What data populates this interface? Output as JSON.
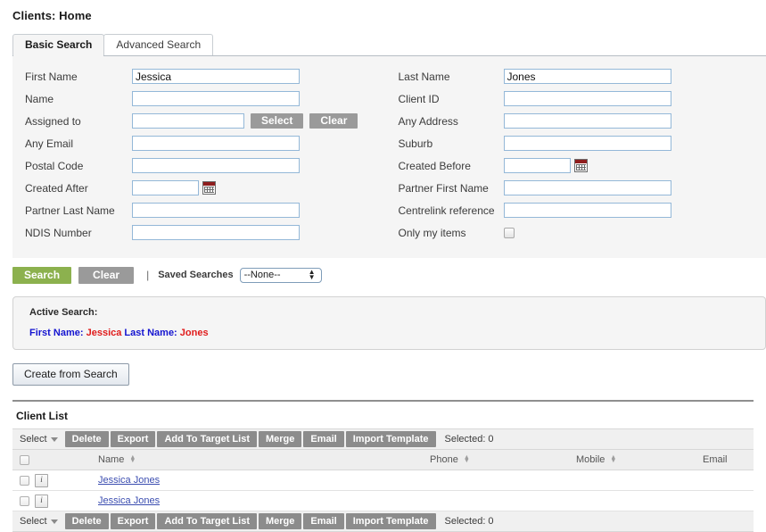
{
  "page": {
    "title": "Clients: Home"
  },
  "tabs": [
    {
      "label": "Basic Search",
      "active": true
    },
    {
      "label": "Advanced Search",
      "active": false
    }
  ],
  "search_form": {
    "left_fields": [
      {
        "label": "First Name",
        "value": "Jessica",
        "type": "text",
        "width": "w-lg"
      },
      {
        "label": "Name",
        "value": "",
        "type": "text",
        "width": "w-lg"
      },
      {
        "label": "Assigned to",
        "value": "",
        "type": "text-buttons",
        "width": "w-med"
      },
      {
        "label": "Any Email",
        "value": "",
        "type": "text",
        "width": "w-lg"
      },
      {
        "label": "Postal Code",
        "value": "",
        "type": "text",
        "width": "w-lg"
      },
      {
        "label": "Created After",
        "value": "",
        "type": "date",
        "width": "w-date"
      },
      {
        "label": "Partner Last Name",
        "value": "",
        "type": "text",
        "width": "w-lg"
      },
      {
        "label": "NDIS Number",
        "value": "",
        "type": "text",
        "width": "w-lg"
      }
    ],
    "right_fields": [
      {
        "label": "Last Name",
        "value": "Jones",
        "type": "text",
        "width": "w-lg"
      },
      {
        "label": "Client ID",
        "value": "",
        "type": "text",
        "width": "w-lg"
      },
      {
        "label": "Any Address",
        "value": "",
        "type": "text",
        "width": "w-lg"
      },
      {
        "label": "Suburb",
        "value": "",
        "type": "text",
        "width": "w-lg"
      },
      {
        "label": "Created Before",
        "value": "",
        "type": "date",
        "width": "w-date"
      },
      {
        "label": "Partner First Name",
        "value": "",
        "type": "text",
        "width": "w-lg"
      },
      {
        "label": "Centrelink reference",
        "value": "",
        "type": "text",
        "width": "w-lg"
      },
      {
        "label": "Only my items",
        "value": "",
        "type": "checkbox",
        "width": ""
      }
    ],
    "assigned_select_label": "Select",
    "assigned_clear_label": "Clear"
  },
  "actions": {
    "search_label": "Search",
    "clear_label": "Clear",
    "divider": "|",
    "saved_searches_label": "Saved Searches",
    "saved_searches_value": "--None--"
  },
  "active_search": {
    "title": "Active Search:",
    "terms": [
      {
        "key": "First Name:",
        "value": "Jessica"
      },
      {
        "key": "Last Name:",
        "value": "Jones"
      }
    ]
  },
  "create_from_search": {
    "label": "Create from Search"
  },
  "client_list": {
    "title": "Client List",
    "toolbar": {
      "select_label": "Select",
      "buttons": [
        "Delete",
        "Export",
        "Add To Target List",
        "Merge",
        "Email",
        "Import Template"
      ],
      "selected_text": "Selected: 0"
    },
    "columns": [
      {
        "label": "",
        "sortable": false
      },
      {
        "label": "Name",
        "sortable": true
      },
      {
        "label": "Phone",
        "sortable": true
      },
      {
        "label": "Mobile",
        "sortable": true
      },
      {
        "label": "Email",
        "sortable": false
      }
    ],
    "rows": [
      {
        "name": "Jessica Jones",
        "phone": "",
        "mobile": "",
        "email": ""
      },
      {
        "name": "Jessica Jones",
        "phone": "",
        "mobile": "",
        "email": ""
      }
    ]
  },
  "colors": {
    "search_green": "#8cb14e",
    "button_gray": "#9a9a9a",
    "panel_bg": "#f5f5f5",
    "input_border": "#94b8d8",
    "term_key": "#1414d0",
    "term_value": "#e01b1b",
    "link": "#3b4db0"
  }
}
